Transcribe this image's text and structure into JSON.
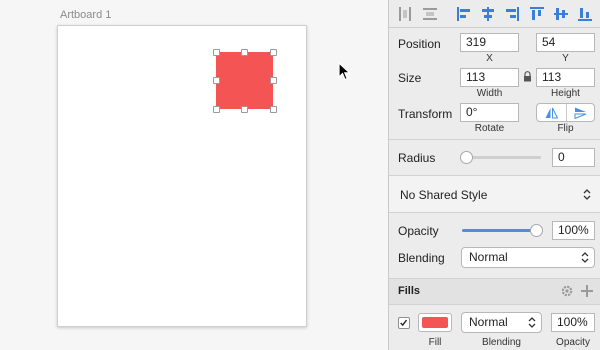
{
  "artboard": {
    "name": "Artboard 1"
  },
  "colors": {
    "shape_fill": "#f55454",
    "accent": "#4a90e2"
  },
  "position": {
    "label": "Position",
    "x_value": "319",
    "x_label": "X",
    "y_value": "54",
    "y_label": "Y"
  },
  "size": {
    "label": "Size",
    "width_value": "113",
    "width_label": "Width",
    "height_value": "113",
    "height_label": "Height",
    "lock_icon": "lock-icon"
  },
  "transform": {
    "label": "Transform",
    "rotate_value": "0°",
    "rotate_label": "Rotate",
    "flip_label": "Flip"
  },
  "radius": {
    "label": "Radius",
    "value": "0",
    "slider_level": 0
  },
  "shared_style": {
    "value": "No Shared Style"
  },
  "opacity": {
    "label": "Opacity",
    "value": "100%",
    "slider_level": 1.0
  },
  "blending": {
    "label": "Blending",
    "value": "Normal"
  },
  "fills": {
    "header": "Fills",
    "item": {
      "checked": true,
      "color": "#f55454",
      "blending": "Normal",
      "opacity": "100%",
      "fill_label": "Fill",
      "blending_label": "Blending",
      "opacity_label": "Opacity"
    }
  }
}
